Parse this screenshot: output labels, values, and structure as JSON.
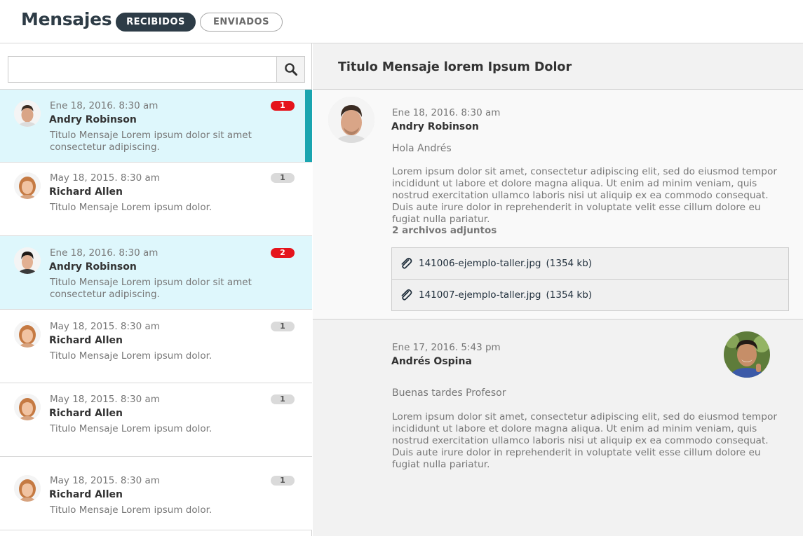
{
  "header": {
    "title": "Mensajes",
    "tabs": [
      {
        "label": "RECIBIDOS",
        "active": true
      },
      {
        "label": "ENVIADOS",
        "active": false
      }
    ]
  },
  "search": {
    "value": "",
    "placeholder": "",
    "icon": "search-icon"
  },
  "messages": [
    {
      "date": "Ene 18, 2016. 8:30 am",
      "sender": "Andry Robinson",
      "preview": "Titulo Mensaje Lorem ipsum dolor sit amet consectetur adipiscing.",
      "badge": "1",
      "badge_color": "#e5141c",
      "unread": true,
      "selected": true,
      "avatar": "male-avatar-1"
    },
    {
      "date": "May 18, 2015. 8:30 am",
      "sender": "Richard Allen",
      "preview": "Titulo Mensaje Lorem ipsum dolor.",
      "badge": "1",
      "badge_color": "#dadada",
      "unread": false,
      "avatar": "female-avatar"
    },
    {
      "date": "Ene 18, 2016. 8:30 am",
      "sender": "Andry Robinson",
      "preview": "Titulo Mensaje Lorem ipsum dolor sit amet consectetur adipiscing.",
      "badge": "2",
      "badge_color": "#e5141c",
      "unread": true,
      "avatar": "male-avatar-2"
    },
    {
      "date": "May 18, 2015. 8:30 am",
      "sender": "Richard Allen",
      "preview": "Titulo Mensaje Lorem ipsum dolor.",
      "badge": "1",
      "badge_color": "#dadada",
      "unread": false,
      "avatar": "female-avatar"
    },
    {
      "date": "May 18, 2015. 8:30 am",
      "sender": "Richard Allen",
      "preview": "Titulo Mensaje Lorem ipsum dolor.",
      "badge": "1",
      "badge_color": "#dadada",
      "unread": false,
      "avatar": "female-avatar"
    },
    {
      "date": "May 18, 2015. 8:30 am",
      "sender": "Richard Allen",
      "preview": "Titulo Mensaje Lorem ipsum dolor.",
      "badge": "1",
      "badge_color": "#dadada",
      "unread": false,
      "avatar": "female-avatar"
    }
  ],
  "thread": {
    "title": "Titulo Mensaje lorem Ipsum Dolor",
    "messages": [
      {
        "date": "Ene 18, 2016. 8:30 am",
        "sender": "Andry Robinson",
        "greeting": "Hola Andrés",
        "body": "Lorem ipsum dolor sit amet, consectetur adipiscing elit, sed do eiusmod tempor incididunt ut labore et dolore magna aliqua. Ut enim ad minim veniam, quis nostrud exercitation ullamco laboris nisi ut aliquip ex ea commodo consequat. Duis aute irure dolor in reprehenderit in voluptate velit esse cillum dolore eu fugiat nulla pariatur.",
        "attachments_label": "2 archivos adjuntos",
        "attachments": [
          {
            "name": "141006-ejemplo-taller.jpg",
            "size": "(1354 kb)"
          },
          {
            "name": "141007-ejemplo-taller.jpg",
            "size": "(1354 kb)"
          }
        ],
        "avatar": "male-avatar-1"
      },
      {
        "date": "Ene 17, 2016. 5:43 pm",
        "sender": "Andrés Ospina",
        "greeting": "Buenas tardes Profesor",
        "body": "Lorem ipsum dolor sit amet, consectetur adipiscing elit, sed do eiusmod tempor incididunt ut labore et dolore magna aliqua. Ut enim ad minim veniam, quis nostrud exercitation ullamco laboris nisi ut aliquip ex ea commodo consequat. Duis aute irure dolor in reprehenderit in voluptate velit esse cillum dolore eu fugiat nulla pariatur.",
        "avatar": "smiling-male-avatar"
      }
    ]
  },
  "colors": {
    "accent": "#1aa5b0",
    "unread_bg": "#def7fc",
    "badge_red": "#e5141c",
    "dark": "#2d3c47"
  }
}
